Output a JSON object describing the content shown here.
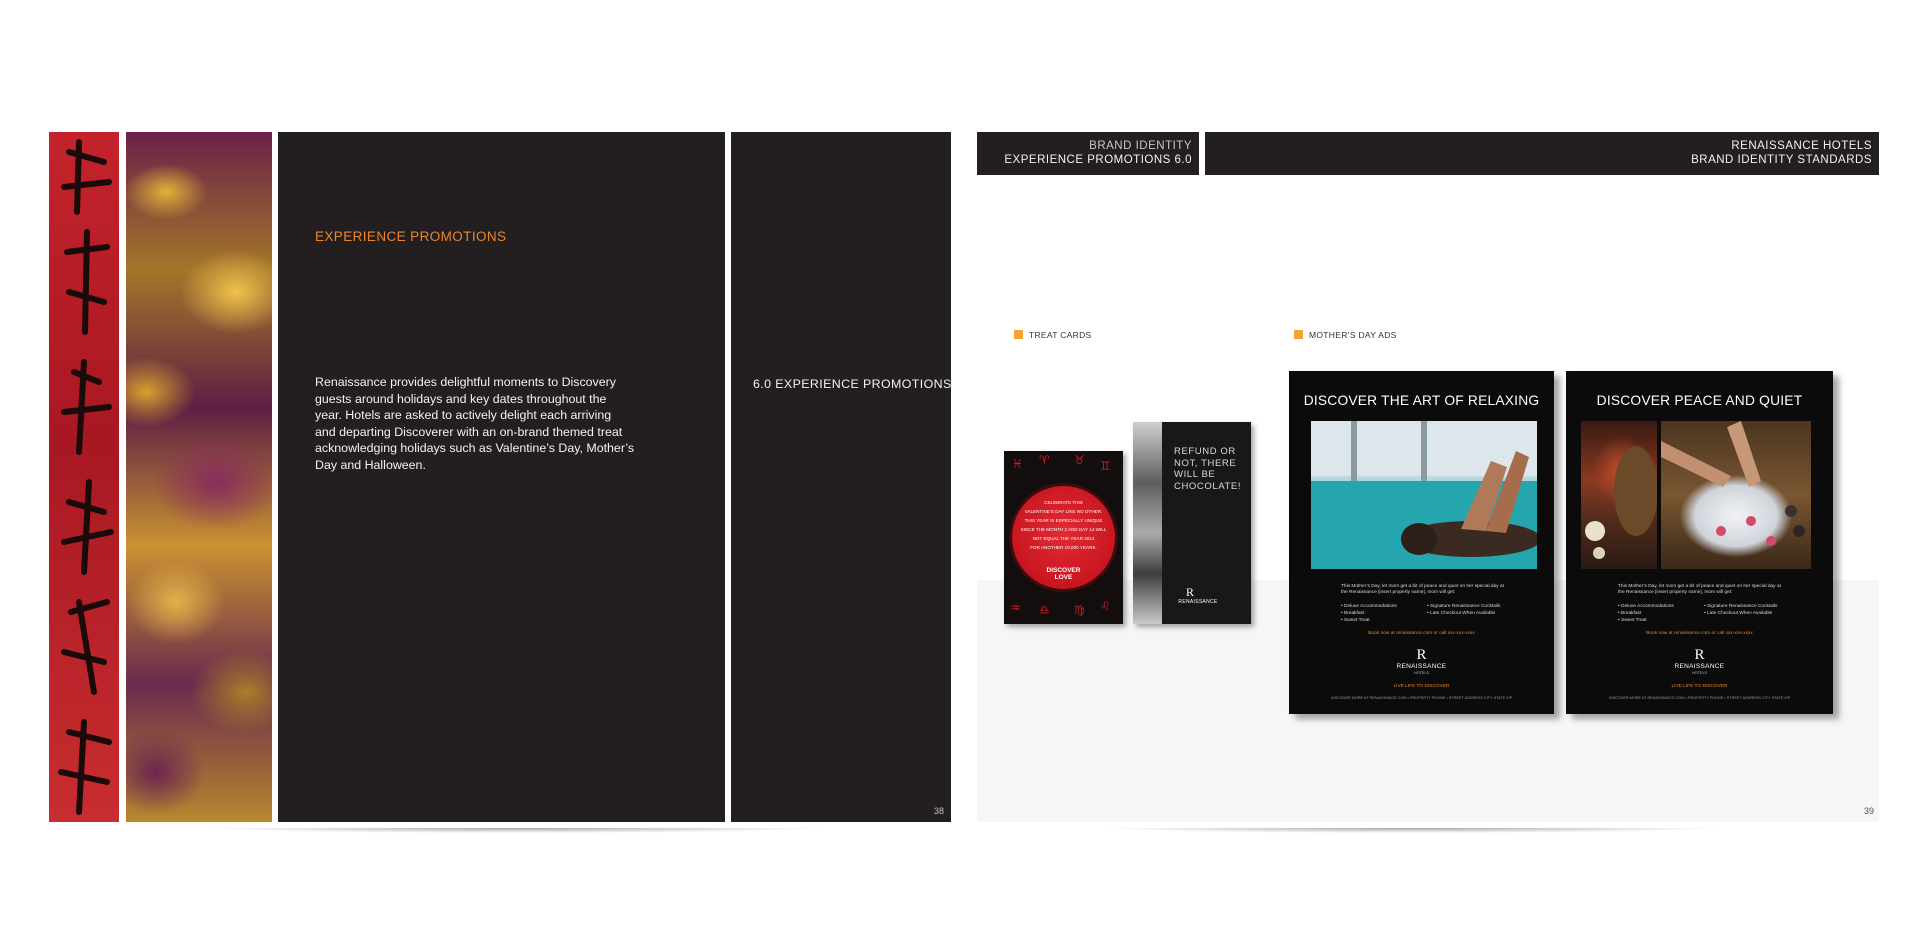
{
  "left_page": {
    "heading": "EXPERIENCE PROMOTIONS",
    "body_lines": [
      "Renaissance provides delightful moments to Discovery",
      "guests around holidays and key dates throughout the",
      "year. Hotels are asked to actively delight each arriving",
      "and departing Discoverer with an on-brand themed treat",
      "acknowledging holidays such as Valentine’s Day, Mother’s",
      "Day and Halloween."
    ],
    "section_title": "6.0  EXPERIENCE PROMOTIONS",
    "page_number": "38"
  },
  "right_page": {
    "header_left": {
      "line1": "BRAND IDENTITY",
      "line2": "EXPERIENCE PROMOTIONS  6.0"
    },
    "header_right": {
      "line1": "RENAISSANCE HOTELS",
      "line2": "BRAND IDENTITY STANDARDS"
    },
    "labels": {
      "treat_cards": "TREAT CARDS",
      "mothers_day_ads": "MOTHER’S DAY ADS"
    },
    "page_number": "39",
    "accent_color": "#f5a335"
  },
  "treat_cards": {
    "red_card": {
      "lines": [
        "CELEBRATE THIS",
        "VALENTINE’S DAY LIKE NO OTHER.",
        "THIS YEAR IS ESPECIALLY UNIQUE",
        "SINCE THE MONTH 2 AND DAY 14 WILL",
        "NOT EQUAL THE YEAR 2014",
        "FOR ANOTHER 10,000 YEARS."
      ],
      "logo_line1": "DISCOVER",
      "logo_line2": "LOVE"
    },
    "black_card": {
      "lines": [
        "REFUND OR",
        "NOT, THERE",
        "WILL BE",
        "CHOCOLATE!"
      ],
      "logo_mark": "R",
      "logo_word": "RENAISSANCE"
    }
  },
  "mothers_day_ads": [
    {
      "title": "DISCOVER THE ART OF RELAXING",
      "copy": "This Mother’s Day, let mom get a bit of peace and quiet on her special day at the Renaissance [insert property name], mom will get:",
      "list_left": [
        "• Deluxe Accommodations",
        "• Breakfast",
        "• Sweet Treat"
      ],
      "list_right": [
        "• Signature Renaissance Cocktails",
        "• Late Checkout When Available"
      ],
      "cta": "Book now at renaissance.com or call xxx-xxx-xxxx",
      "logo_mark": "R",
      "brand": "RENAISSANCE",
      "hotels": "HOTELS",
      "tagline": "LIVE LIFE TO DISCOVER",
      "footer": "DISCOVER MORE AT RENAISSANCE.COM  •  PROPERTY PHONE  •  STREET ADDRESS CITY STATE ZIP"
    },
    {
      "title": "DISCOVER PEACE AND QUIET",
      "copy": "This Mother’s Day, let mom get a bit of peace and quiet on her special day at the Renaissance [insert property name], mom will get:",
      "list_left": [
        "• Deluxe Accommodations",
        "• Breakfast",
        "• Sweet Treat"
      ],
      "list_right": [
        "• Signature Renaissance Cocktails",
        "• Late Checkout When Available"
      ],
      "cta": "Book now at renaissance.com or call xxx-xxx-xxxx",
      "logo_mark": "R",
      "brand": "RENAISSANCE",
      "hotels": "HOTELS",
      "tagline": "LIVE LIFE TO DISCOVER",
      "footer": "DISCOVER MORE AT RENAISSANCE.COM  •  PROPERTY PHONE  •  STREET ADDRESS CITY STATE ZIP"
    }
  ]
}
